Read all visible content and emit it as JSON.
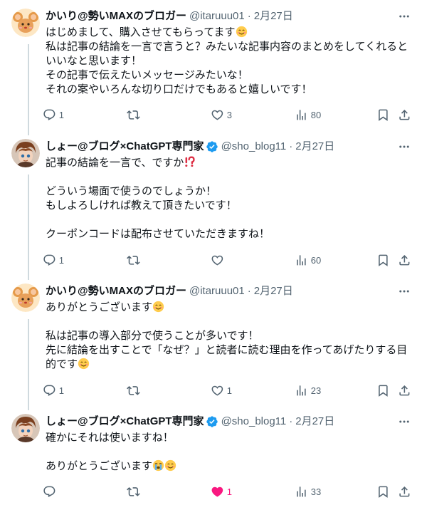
{
  "thread": [
    {
      "avatar": "mouse-avatar",
      "name": "かいり@勢いMAXのブロガー",
      "handle": "@itaruuu01",
      "date": "2月27日",
      "verified": false,
      "lines": [
        {
          "text": "はじめまして、購入させてもらってます",
          "emoji": "smiling-face-emoji"
        },
        {
          "text": "私は記事の結論を一言で言うと？みたいな記事内容のまとめをしてくれると"
        },
        {
          "text": "いいなと思います！"
        },
        {
          "text": "その記事で伝えたいメッセージみたいな！"
        },
        {
          "text": "それの案やいろんな切り口だけでもあると嬉しいです！"
        }
      ],
      "stats": {
        "replies": "1",
        "reposts": "",
        "likes": "3",
        "views": "80"
      },
      "liked": false
    },
    {
      "avatar": "anime-boy-avatar",
      "name": "しょー@ブログ×ChatGPT専門家",
      "handle": "@sho_blog11",
      "date": "2月27日",
      "verified": true,
      "lines": [
        {
          "text": "記事の結論を一言で、ですか",
          "emoji": "exclamation-question-emoji"
        },
        {
          "text": ""
        },
        {
          "text": "どういう場面で使うのでしょうか！"
        },
        {
          "text": "もしよろしければ教えて頂きたいです！"
        },
        {
          "text": ""
        },
        {
          "text": "クーポンコードは配布させていただきますね！"
        }
      ],
      "stats": {
        "replies": "1",
        "reposts": "",
        "likes": "",
        "views": "60"
      },
      "liked": false
    },
    {
      "avatar": "mouse-avatar",
      "name": "かいり@勢いMAXのブロガー",
      "handle": "@itaruuu01",
      "date": "2月27日",
      "verified": false,
      "lines": [
        {
          "text": "ありがとうございます",
          "emoji": "smiling-face-emoji"
        },
        {
          "text": ""
        },
        {
          "text": "私は記事の導入部分で使うことが多いです！"
        },
        {
          "text": "先に結論を出すことで「なぜ？」と読者に読む理由を作ってあげたりする目"
        },
        {
          "text": "的です",
          "emoji": "smiling-face-emoji"
        }
      ],
      "stats": {
        "replies": "1",
        "reposts": "",
        "likes": "1",
        "views": "23"
      },
      "liked": false
    },
    {
      "avatar": "anime-boy-avatar",
      "name": "しょー@ブログ×ChatGPT専門家",
      "handle": "@sho_blog11",
      "date": "2月27日",
      "verified": true,
      "lines": [
        {
          "text": "確かにそれは使いますね！"
        },
        {
          "text": ""
        },
        {
          "text": "ありがとうございます",
          "emoji": "crying-face-emoji",
          "emoji2": "smiling-face-emoji"
        }
      ],
      "stats": {
        "replies": "",
        "reposts": "",
        "likes": "1",
        "views": "33"
      },
      "liked": true
    }
  ],
  "separator": "·",
  "colors": {
    "text": "#0f1419",
    "secondary": "#536471",
    "like_active": "#f91880",
    "verified": "#1d9bf0",
    "thread_line": "#cfd9de"
  }
}
